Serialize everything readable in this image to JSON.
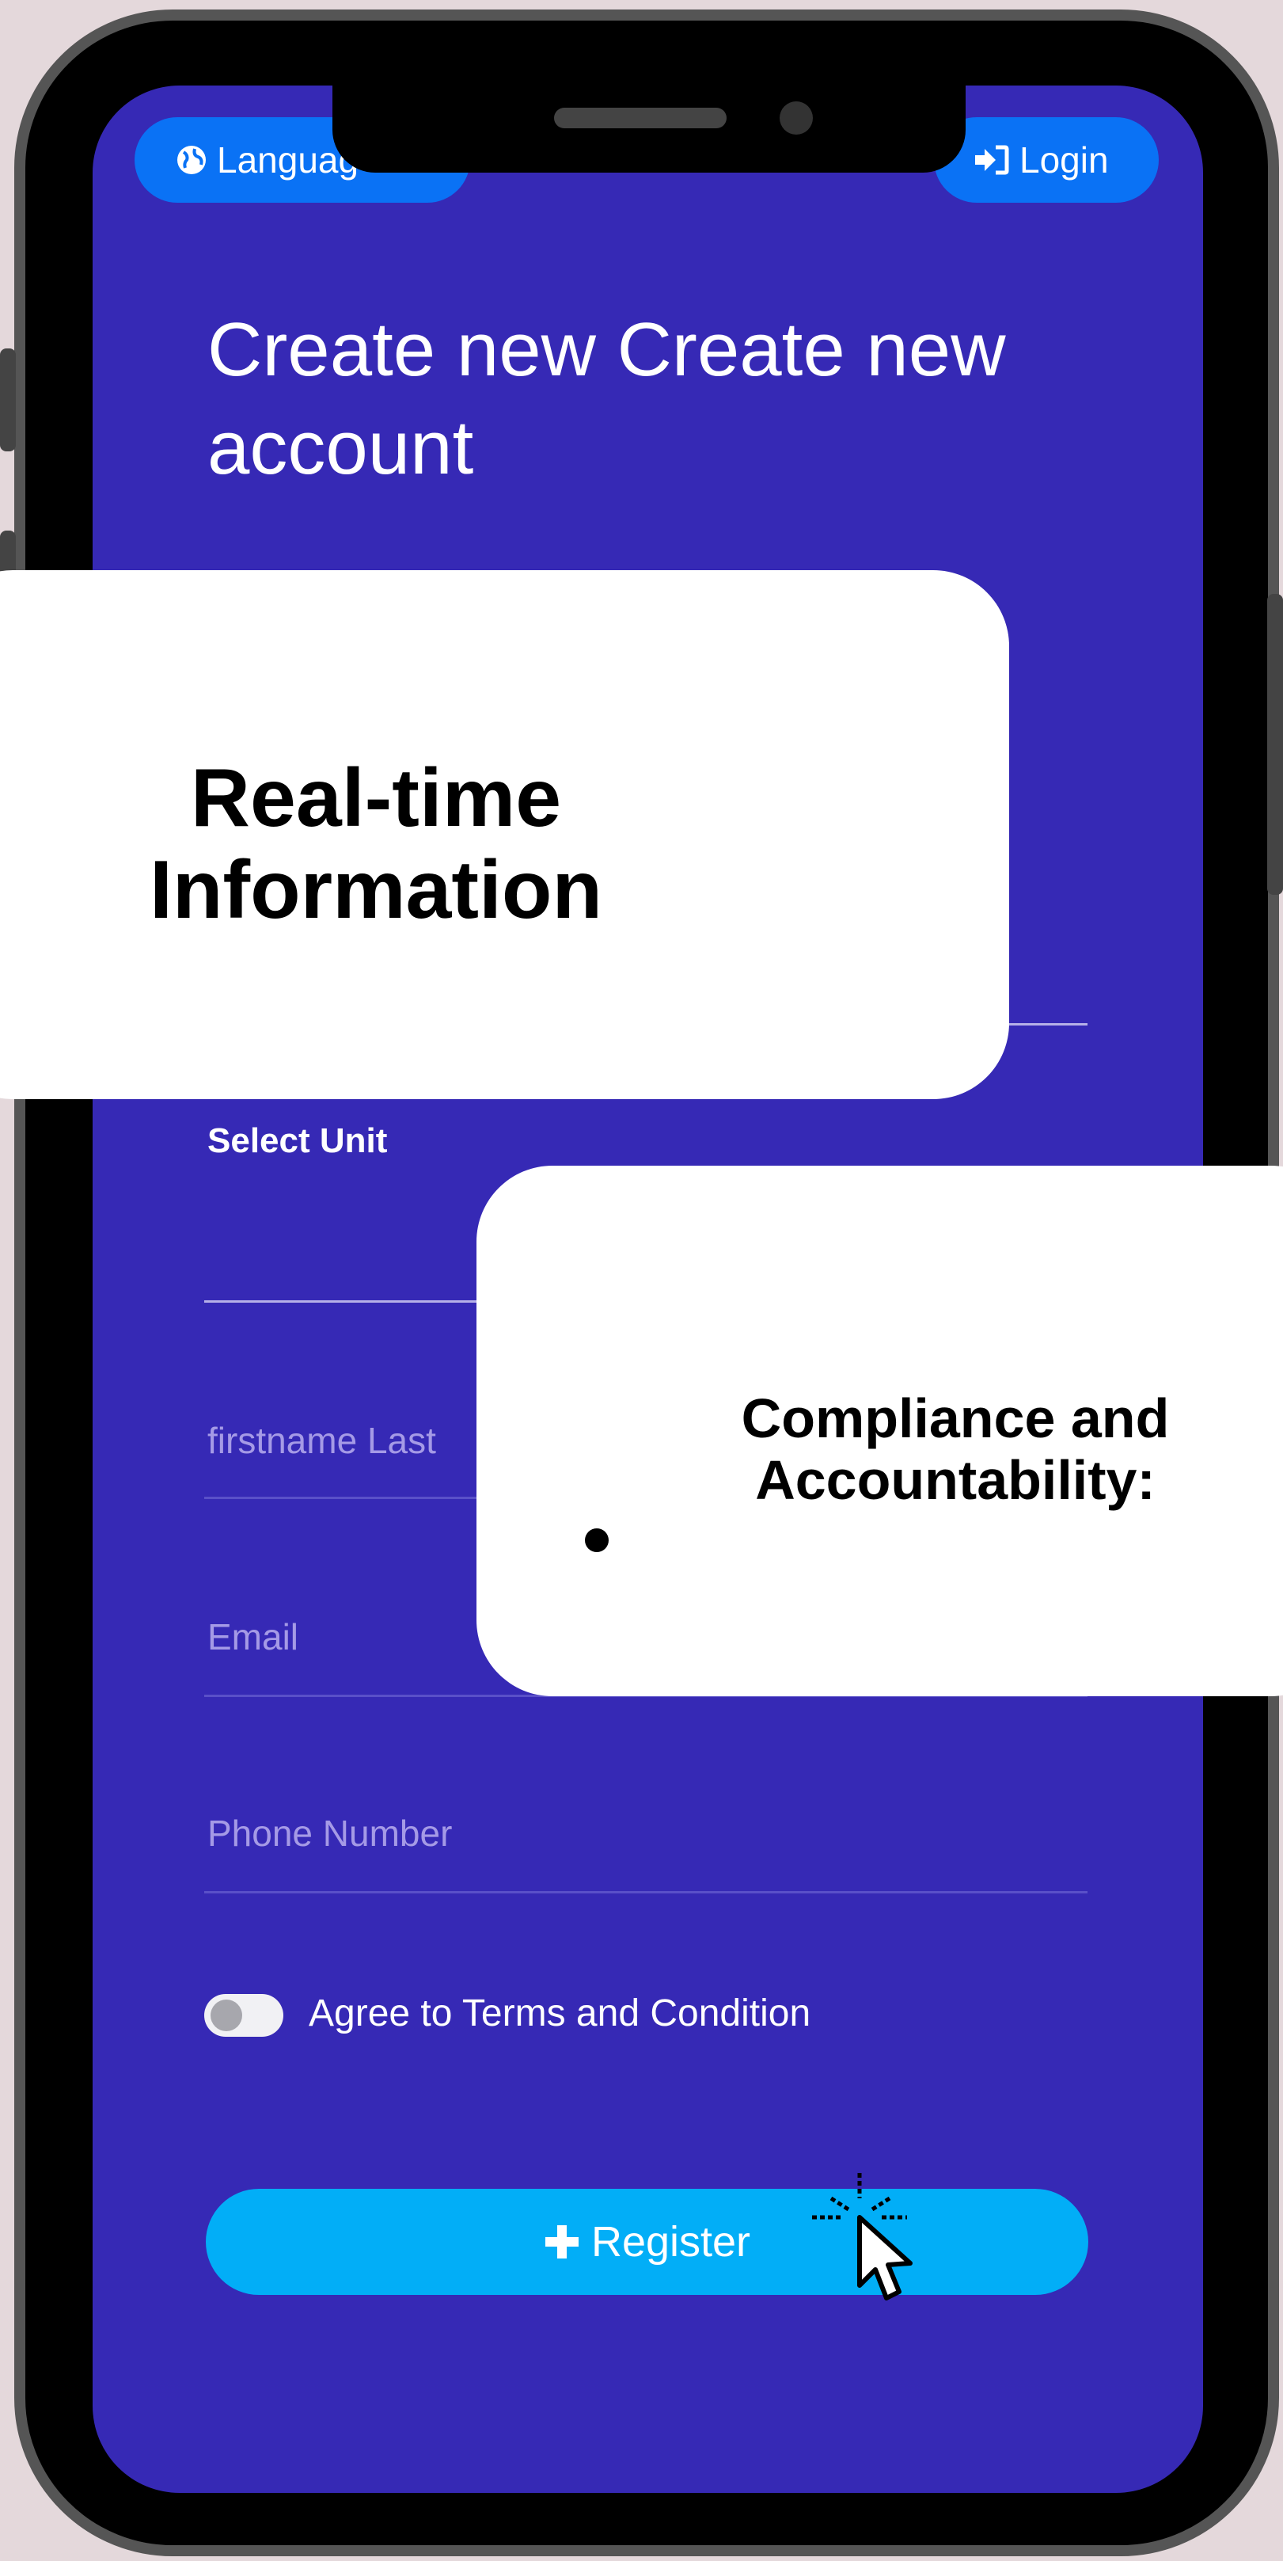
{
  "header": {
    "language_label": "Languag",
    "login_label": "Login"
  },
  "form": {
    "title": "Create new Create new account",
    "select_unit_label": "Select Unit",
    "name_placeholder": "firstname Last",
    "email_placeholder": "Email",
    "phone_placeholder": "Phone Number",
    "agree_label": "Agree to Terms and Condition",
    "agree_checked": false,
    "register_label": "Register"
  },
  "overlays": {
    "card1_title": "Real-time Information",
    "card2_title": "Compliance and Accountability:"
  },
  "icons": {
    "language": "globe-icon",
    "login": "sign-in-icon",
    "register": "plus-icon",
    "cursor": "mouse-pointer-icon"
  },
  "colors": {
    "screen_bg": "#3629b5",
    "pill_blue": "#0a72f5",
    "register_blue": "#02aef7",
    "page_bg": "#e4d8db"
  }
}
